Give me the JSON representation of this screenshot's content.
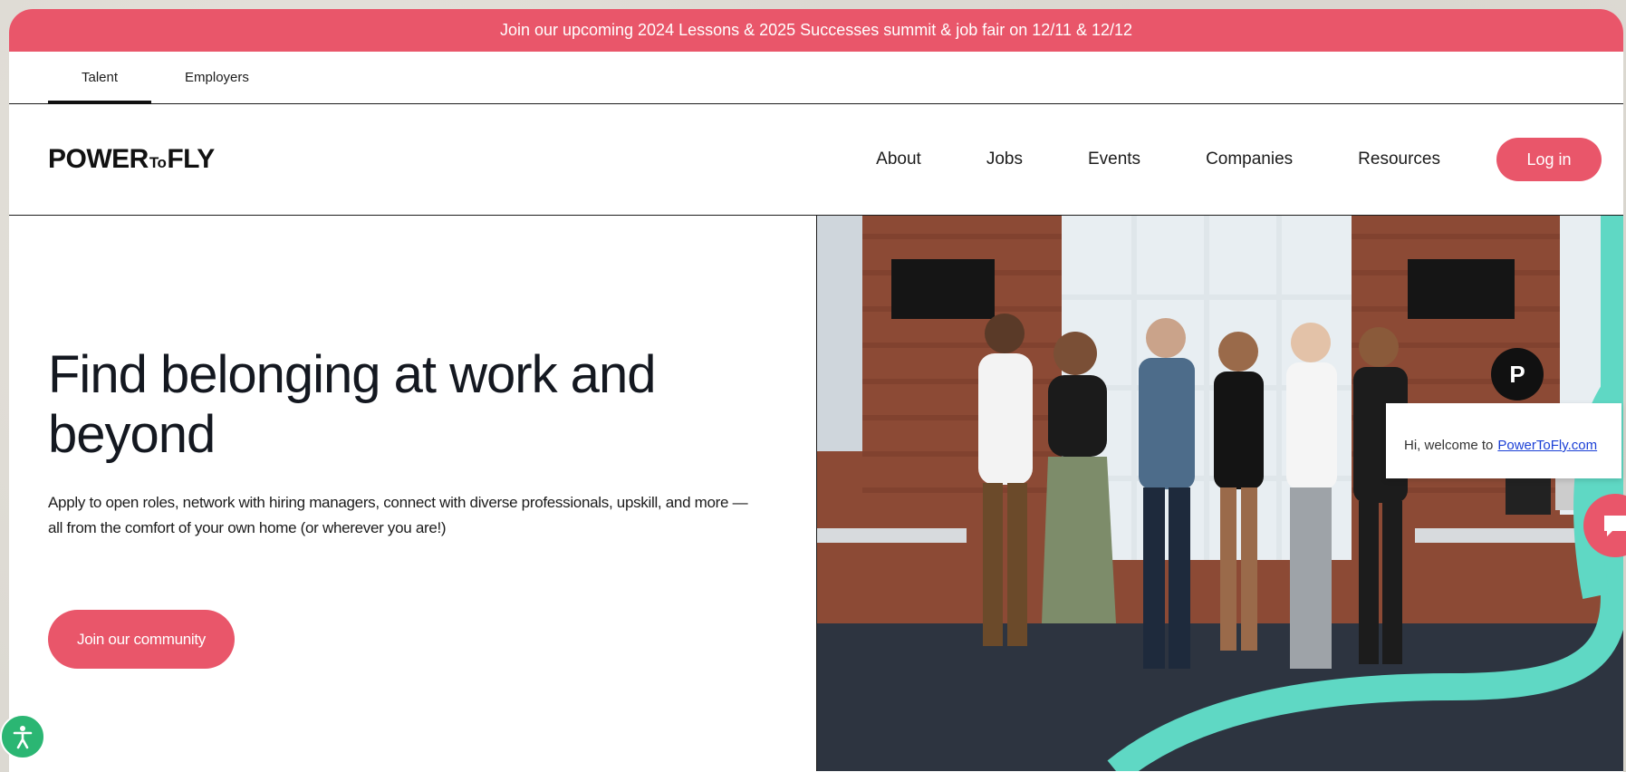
{
  "announcement": {
    "text": "Join our upcoming 2024 Lessons & 2025 Successes summit & job fair on 12/11 & 12/12"
  },
  "audience_tabs": [
    {
      "label": "Talent",
      "active": true
    },
    {
      "label": "Employers",
      "active": false
    }
  ],
  "header": {
    "logo_left": "POWER",
    "logo_mid": "To",
    "logo_right": "FLY",
    "nav": [
      "About",
      "Jobs",
      "Events",
      "Companies",
      "Resources"
    ],
    "login_label": "Log in"
  },
  "hero": {
    "title": "Find belonging at work and beyond",
    "description": "Apply to open roles, network with hiring managers, connect with diverse professionals, upskill, and more — all from the comfort of your own home (or wherever you are!)",
    "cta_label": "Join our community",
    "image_icon": "group-photo"
  },
  "chat": {
    "greeting": "Hi, welcome to",
    "link_text": "PowerToFly.com",
    "avatar_letter": "P",
    "launcher_icon": "chat-bubble-icon"
  },
  "accessibility": {
    "icon": "accessibility-icon"
  },
  "colors": {
    "accent": "#e9566a",
    "teal": "#5fd8c4",
    "text": "#141820"
  }
}
